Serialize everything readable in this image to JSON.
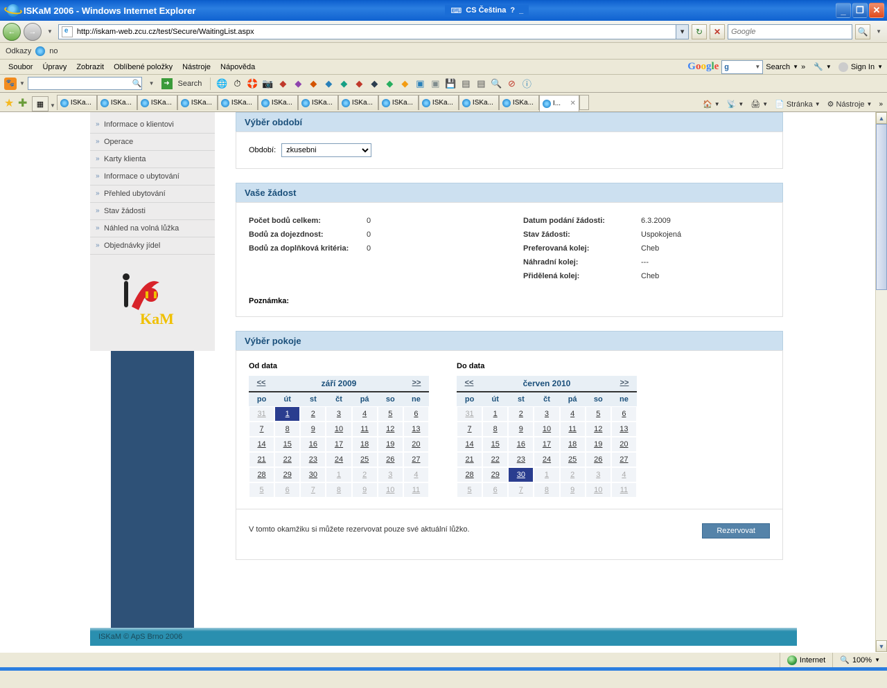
{
  "titlebar": {
    "title": "ISKaM 2006 - Windows Internet Explorer",
    "lang": "CS Čeština"
  },
  "address": {
    "url": "http://iskam-web.zcu.cz/test/Secure/WaitingList.aspx",
    "search_placeholder": "Google"
  },
  "linksbar": {
    "label": "Odkazy",
    "item1": "no"
  },
  "menu": {
    "items": [
      "Soubor",
      "Úpravy",
      "Zobrazit",
      "Oblíbené položky",
      "Nástroje",
      "Nápověda"
    ],
    "search_label": "Search",
    "more": "»",
    "signin": "Sign In"
  },
  "toolbar2": {
    "search_btn": "Search"
  },
  "tabs": {
    "generic": "ISKa...",
    "active": "I...",
    "right": {
      "page": "Stránka",
      "tools": "Nástroje"
    }
  },
  "sidebar": {
    "items": [
      "Informace o klientovi",
      "Operace",
      "Karty klienta",
      "Informace o ubytování",
      "Přehled ubytování",
      "Stav žádosti",
      "Náhled na volná lůžka",
      "Objednávky jídel"
    ]
  },
  "panels": {
    "period": {
      "title": "Výběr období",
      "label": "Období:",
      "value": "zkusebni"
    },
    "request": {
      "title": "Vaše žádost",
      "left": [
        {
          "label": "Počet bodů celkem:",
          "value": "0"
        },
        {
          "label": "Bodů za dojezdnost:",
          "value": "0"
        },
        {
          "label": "Bodů za doplňková kritéria:",
          "value": "0"
        }
      ],
      "right": [
        {
          "label": "Datum podání žádosti:",
          "value": "6.3.2009"
        },
        {
          "label": "Stav žádosti:",
          "value": "Uspokojená"
        },
        {
          "label": "Preferovaná kolej:",
          "value": "Cheb"
        },
        {
          "label": "Náhradní kolej:",
          "value": "---"
        },
        {
          "label": "Přidělená kolej:",
          "value": "Cheb"
        }
      ],
      "note_label": "Poznámka:"
    },
    "room": {
      "title": "Výběr pokoje",
      "from_label": "Od data",
      "to_label": "Do data",
      "prev": "<<",
      "next": ">>",
      "dow": [
        "po",
        "út",
        "st",
        "čt",
        "pá",
        "so",
        "ne"
      ],
      "cal_from": {
        "month": "září 2009",
        "selected": "1",
        "rows": [
          [
            {
              "d": "31",
              "o": true
            },
            {
              "d": "1",
              "s": true
            },
            {
              "d": "2"
            },
            {
              "d": "3"
            },
            {
              "d": "4"
            },
            {
              "d": "5"
            },
            {
              "d": "6"
            }
          ],
          [
            {
              "d": "7"
            },
            {
              "d": "8"
            },
            {
              "d": "9"
            },
            {
              "d": "10"
            },
            {
              "d": "11"
            },
            {
              "d": "12"
            },
            {
              "d": "13"
            }
          ],
          [
            {
              "d": "14"
            },
            {
              "d": "15"
            },
            {
              "d": "16"
            },
            {
              "d": "17"
            },
            {
              "d": "18"
            },
            {
              "d": "19"
            },
            {
              "d": "20"
            }
          ],
          [
            {
              "d": "21"
            },
            {
              "d": "22"
            },
            {
              "d": "23"
            },
            {
              "d": "24"
            },
            {
              "d": "25"
            },
            {
              "d": "26"
            },
            {
              "d": "27"
            }
          ],
          [
            {
              "d": "28"
            },
            {
              "d": "29"
            },
            {
              "d": "30"
            },
            {
              "d": "1",
              "o": true
            },
            {
              "d": "2",
              "o": true
            },
            {
              "d": "3",
              "o": true
            },
            {
              "d": "4",
              "o": true
            }
          ],
          [
            {
              "d": "5",
              "o": true
            },
            {
              "d": "6",
              "o": true
            },
            {
              "d": "7",
              "o": true
            },
            {
              "d": "8",
              "o": true
            },
            {
              "d": "9",
              "o": true
            },
            {
              "d": "10",
              "o": true
            },
            {
              "d": "11",
              "o": true
            }
          ]
        ]
      },
      "cal_to": {
        "month": "červen 2010",
        "selected": "30",
        "rows": [
          [
            {
              "d": "31",
              "o": true
            },
            {
              "d": "1"
            },
            {
              "d": "2"
            },
            {
              "d": "3"
            },
            {
              "d": "4"
            },
            {
              "d": "5"
            },
            {
              "d": "6"
            }
          ],
          [
            {
              "d": "7"
            },
            {
              "d": "8"
            },
            {
              "d": "9"
            },
            {
              "d": "10"
            },
            {
              "d": "11"
            },
            {
              "d": "12"
            },
            {
              "d": "13"
            }
          ],
          [
            {
              "d": "14"
            },
            {
              "d": "15"
            },
            {
              "d": "16"
            },
            {
              "d": "17"
            },
            {
              "d": "18"
            },
            {
              "d": "19"
            },
            {
              "d": "20"
            }
          ],
          [
            {
              "d": "21"
            },
            {
              "d": "22"
            },
            {
              "d": "23"
            },
            {
              "d": "24"
            },
            {
              "d": "25"
            },
            {
              "d": "26"
            },
            {
              "d": "27"
            }
          ],
          [
            {
              "d": "28"
            },
            {
              "d": "29"
            },
            {
              "d": "30",
              "s": true
            },
            {
              "d": "1",
              "o": true
            },
            {
              "d": "2",
              "o": true
            },
            {
              "d": "3",
              "o": true
            },
            {
              "d": "4",
              "o": true
            }
          ],
          [
            {
              "d": "5",
              "o": true
            },
            {
              "d": "6",
              "o": true
            },
            {
              "d": "7",
              "o": true
            },
            {
              "d": "8",
              "o": true
            },
            {
              "d": "9",
              "o": true
            },
            {
              "d": "10",
              "o": true
            },
            {
              "d": "11",
              "o": true
            }
          ]
        ]
      },
      "reserve_note": "V tomto okamžiku si můžete rezervovat pouze své aktuální lůžko.",
      "reserve_btn": "Rezervovat"
    }
  },
  "footer": "ISKaM © ApS Brno 2006",
  "statusbar": {
    "zone": "Internet",
    "zoom": "100%"
  }
}
